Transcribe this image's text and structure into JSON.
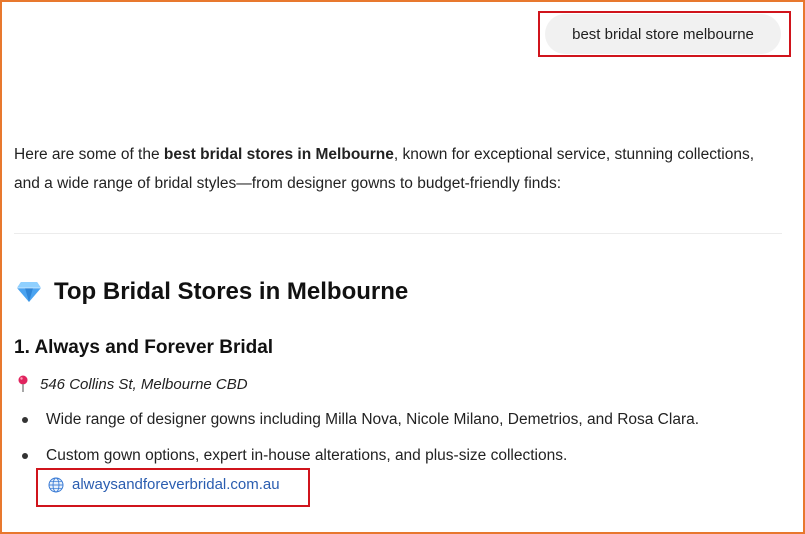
{
  "chat": {
    "user_query": "best bridal store melbourne"
  },
  "answer": {
    "intro_prefix": "Here are some of the ",
    "intro_bold": "best bridal stores in Melbourne",
    "intro_suffix": ", known for exceptional service, stunning collections, and a wide range of bridal styles—from designer gowns to budget-friendly finds:",
    "section_icon": "gem-icon",
    "section_title": "Top Bridal Stores in Melbourne",
    "store": {
      "number": "1.",
      "name": "Always and Forever Bridal",
      "address_icon": "pin-icon",
      "address": "546 Collins St, Melbourne CBD",
      "bullets": [
        "Wide range of designer gowns including Milla Nova, Nicole Milano, Demetrios, and Rosa Clara.",
        "Custom gown options, expert in-house alterations, and plus-size collections."
      ],
      "link_icon": "globe-icon",
      "link_text": "alwaysandforeverbridal.com.au"
    }
  },
  "colors": {
    "frame_border": "#e8782e",
    "highlight_box": "#d0141c",
    "query_bubble_bg": "#f1f1f1",
    "link": "#2a5db0",
    "gem": "#4aa3f0",
    "pin": "#e0245e"
  }
}
